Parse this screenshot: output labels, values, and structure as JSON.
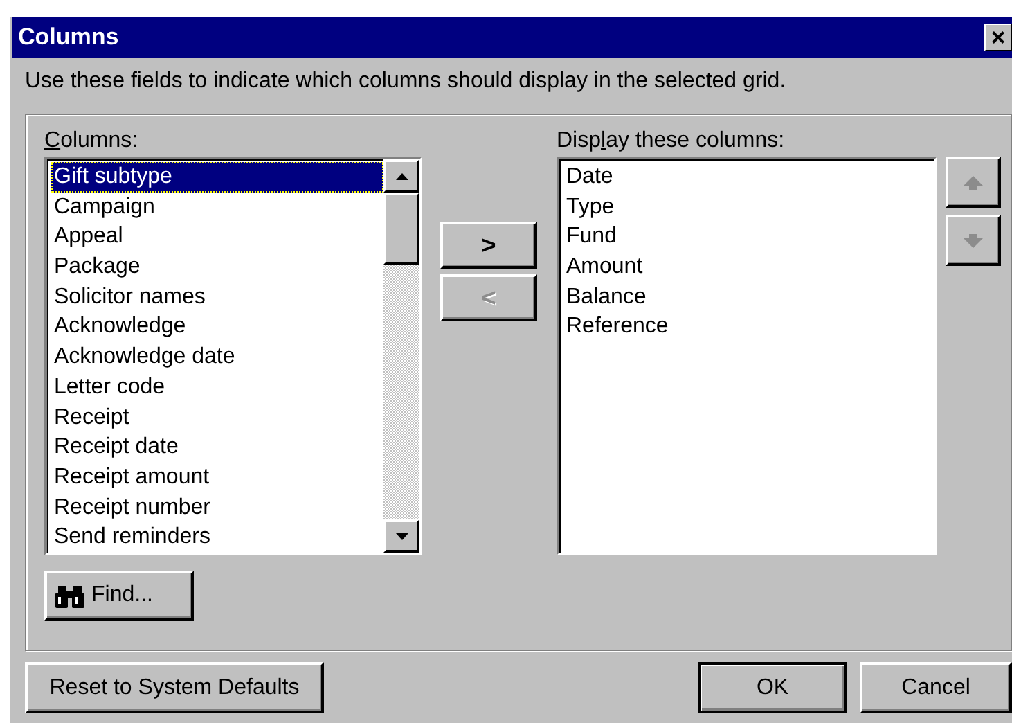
{
  "window": {
    "title": "Columns",
    "close_icon": "×"
  },
  "instruction": "Use these fields to indicate which columns should display in the selected grid.",
  "available": {
    "label_parts": [
      {
        "text": "C",
        "underlined": true
      },
      {
        "text": "olumns:",
        "underlined": false
      }
    ],
    "items": [
      {
        "label": "Gift subtype",
        "selected": true
      },
      {
        "label": "Campaign",
        "selected": false
      },
      {
        "label": "Appeal",
        "selected": false
      },
      {
        "label": "Package",
        "selected": false
      },
      {
        "label": "Solicitor names",
        "selected": false
      },
      {
        "label": "Acknowledge",
        "selected": false
      },
      {
        "label": "Acknowledge date",
        "selected": false
      },
      {
        "label": "Letter code",
        "selected": false
      },
      {
        "label": "Receipt",
        "selected": false
      },
      {
        "label": "Receipt date",
        "selected": false
      },
      {
        "label": "Receipt amount",
        "selected": false
      },
      {
        "label": "Receipt number",
        "selected": false
      },
      {
        "label": "Send reminders",
        "selected": false
      }
    ]
  },
  "move_buttons": [
    {
      "label": ">",
      "disabled": false
    },
    {
      "label": "<",
      "disabled": true
    }
  ],
  "displayed": {
    "label_parts": [
      {
        "text": "Disp",
        "underlined": false
      },
      {
        "text": "l",
        "underlined": true
      },
      {
        "text": "ay these columns:",
        "underlined": false
      }
    ],
    "items": [
      {
        "label": "Date",
        "selected": false
      },
      {
        "label": "Type",
        "selected": false
      },
      {
        "label": "Fund",
        "selected": false
      },
      {
        "label": "Amount",
        "selected": false
      },
      {
        "label": "Balance",
        "selected": false
      },
      {
        "label": "Reference",
        "selected": false
      }
    ]
  },
  "order_buttons": [
    {
      "kind": "up",
      "disabled": true
    },
    {
      "kind": "down",
      "disabled": true
    }
  ],
  "find_button": {
    "label": "Find..."
  },
  "buttons": [
    {
      "label": "Reset to System Defaults"
    },
    {
      "label": "OK",
      "default": true
    },
    {
      "label": "Cancel"
    }
  ]
}
